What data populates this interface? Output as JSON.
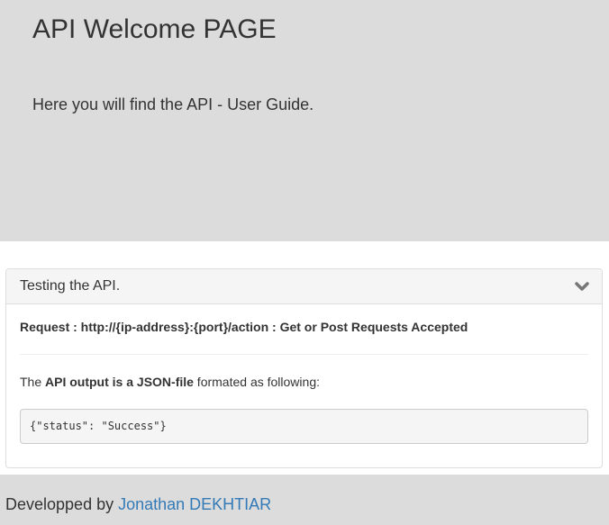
{
  "jumbotron": {
    "title": "API Welcome PAGE",
    "subtitle": "Here you will find the API - User Guide."
  },
  "panel": {
    "title": "Testing the API.",
    "toggle_icon": "chevron-down-icon",
    "request_line": "Request : http://{ip-address}:{port}/action : Get or Post Requests Accepted",
    "output_prefix": "The ",
    "output_bold": "API output is a JSON-file",
    "output_suffix": " formated as following:",
    "code": "{\"status\": \"Success\"}"
  },
  "footer": {
    "prefix": "Developped by ",
    "author_link": "Jonathan DEKHTIAR"
  },
  "colors": {
    "jumbotron_bg": "#dcdcdc",
    "link": "#337ab7",
    "panel_heading_bg": "#f5f5f5"
  }
}
